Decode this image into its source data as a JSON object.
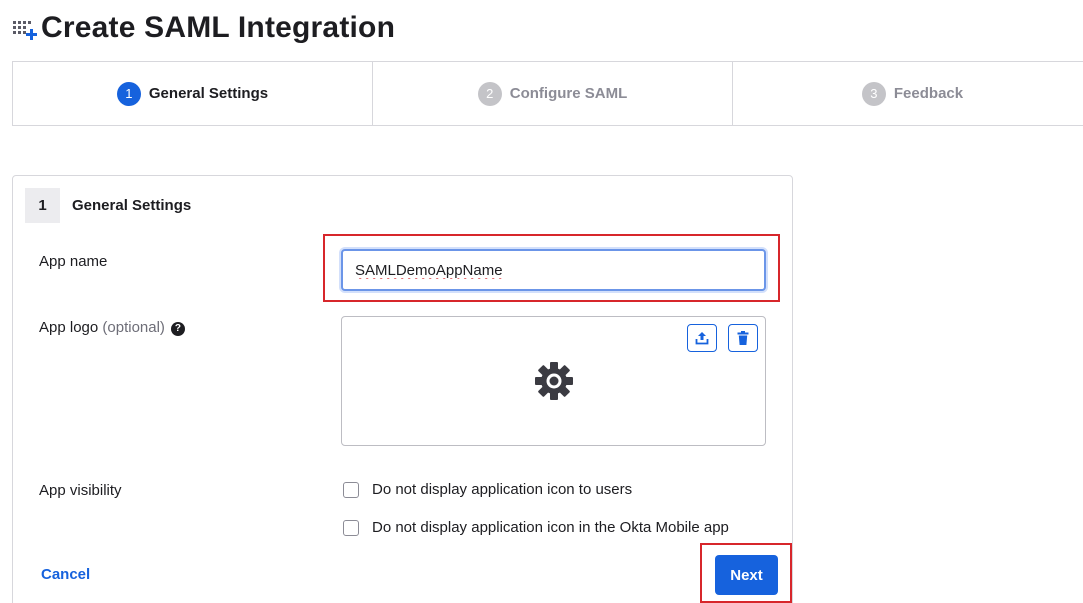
{
  "page": {
    "title": "Create SAML Integration",
    "header_icon": "apps-add-icon"
  },
  "stepper": {
    "steps": [
      {
        "num": "1",
        "label": "General Settings",
        "state": "active"
      },
      {
        "num": "2",
        "label": "Configure SAML",
        "state": "inactive"
      },
      {
        "num": "3",
        "label": "Feedback",
        "state": "inactive"
      }
    ]
  },
  "card": {
    "step_num": "1",
    "title": "General Settings",
    "app_name": {
      "label": "App name",
      "value": "SAMLDemoAppName"
    },
    "app_logo": {
      "label": "App logo",
      "optional": "(optional)",
      "help_icon": "help-icon",
      "upload_icon": "upload-icon",
      "delete_icon": "trash-icon",
      "placeholder_icon": "gear-icon"
    },
    "app_visibility": {
      "label": "App visibility",
      "options": [
        {
          "label": "Do not display application icon to users",
          "checked": false
        },
        {
          "label": "Do not display application icon in the Okta Mobile app",
          "checked": false
        }
      ]
    },
    "cancel_label": "Cancel",
    "next_label": "Next"
  },
  "colors": {
    "accent": "#1662dd",
    "highlight": "#d7262b",
    "border": "#d7d7dc"
  }
}
